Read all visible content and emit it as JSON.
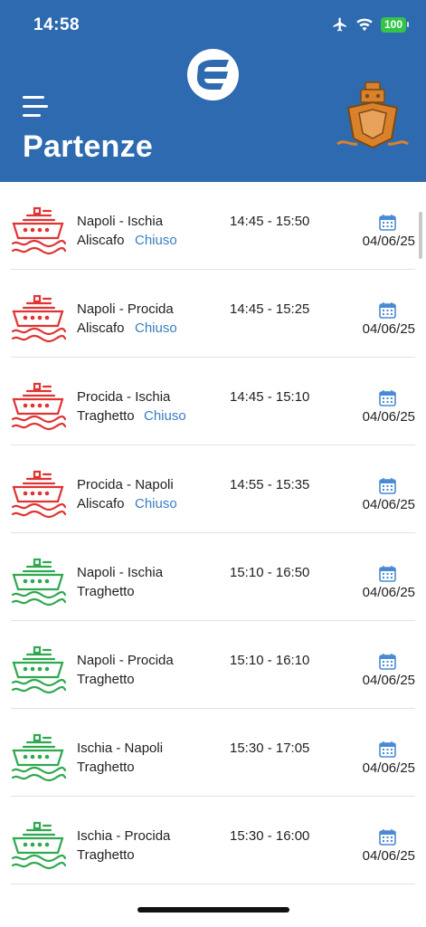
{
  "status_bar": {
    "time": "14:58",
    "battery": "100"
  },
  "header": {
    "title": "Partenze"
  },
  "colors": {
    "header_bg": "#2e6aaf",
    "closed_red": "#e03333",
    "open_green": "#2fa84f",
    "link_blue": "#3a7cc4",
    "ship_logo_orange": "#d9822b"
  },
  "departures": [
    {
      "route": "Napoli - Ischia",
      "time": "14:45 - 15:50",
      "type": "Aliscafo",
      "status": "Chiuso",
      "date": "04/06/25",
      "icon_state": "red"
    },
    {
      "route": "Napoli - Procida",
      "time": "14:45 - 15:25",
      "type": "Aliscafo",
      "status": "Chiuso",
      "date": "04/06/25",
      "icon_state": "red"
    },
    {
      "route": "Procida - Ischia",
      "time": "14:45 - 15:10",
      "type": "Traghetto",
      "status": "Chiuso",
      "date": "04/06/25",
      "icon_state": "red"
    },
    {
      "route": "Procida - Napoli",
      "time": "14:55 - 15:35",
      "type": "Aliscafo",
      "status": "Chiuso",
      "date": "04/06/25",
      "icon_state": "red"
    },
    {
      "route": "Napoli - Ischia",
      "time": "15:10 - 16:50",
      "type": "Traghetto",
      "status": "",
      "date": "04/06/25",
      "icon_state": "green"
    },
    {
      "route": "Napoli - Procida",
      "time": "15:10 - 16:10",
      "type": "Traghetto",
      "status": "",
      "date": "04/06/25",
      "icon_state": "green"
    },
    {
      "route": "Ischia - Napoli",
      "time": "15:30 - 17:05",
      "type": "Traghetto",
      "status": "",
      "date": "04/06/25",
      "icon_state": "green"
    },
    {
      "route": "Ischia - Procida",
      "time": "15:30 - 16:00",
      "type": "Traghetto",
      "status": "",
      "date": "04/06/25",
      "icon_state": "green"
    }
  ]
}
